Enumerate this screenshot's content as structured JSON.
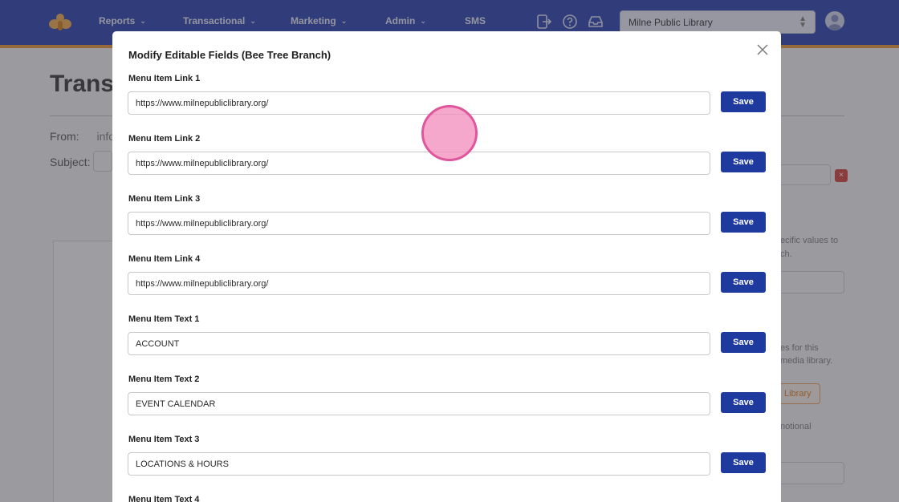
{
  "nav": {
    "items": [
      {
        "label": "Reports",
        "has_menu": true
      },
      {
        "label": "Transactional",
        "has_menu": true
      },
      {
        "label": "Marketing",
        "has_menu": true
      },
      {
        "label": "Admin",
        "has_menu": true
      },
      {
        "label": "SMS",
        "has_menu": false
      }
    ],
    "icons": [
      "sign-out-icon",
      "help-icon",
      "inbox-icon"
    ],
    "org_select": "Milne Public Library",
    "colors": {
      "bar": "#3f51b5",
      "accent": "#e8a04c"
    }
  },
  "background": {
    "title": "Transa",
    "from_label": "From:",
    "from_value": "info",
    "subject_label": "Subject:",
    "right_fragments": [
      ":",
      "ecific values to",
      "ch.",
      "es for this",
      "media library.",
      "notional"
    ],
    "library_button": "Library"
  },
  "modal": {
    "title": "Modify Editable Fields (Bee Tree Branch)",
    "save_label": "Save",
    "fields": [
      {
        "label": "Menu Item Link 1",
        "value": "https://www.milnepubliclibrary.org/"
      },
      {
        "label": "Menu Item Link 2",
        "value": "https://www.milnepubliclibrary.org/"
      },
      {
        "label": "Menu Item Link 3",
        "value": "https://www.milnepubliclibrary.org/"
      },
      {
        "label": "Menu Item Link 4",
        "value": "https://www.milnepubliclibrary.org/"
      },
      {
        "label": "Menu Item Text 1",
        "value": "ACCOUNT"
      },
      {
        "label": "Menu Item Text 2",
        "value": "EVENT CALENDAR"
      },
      {
        "label": "Menu Item Text 3",
        "value": "LOCATIONS & HOURS"
      },
      {
        "label": "Menu Item Text 4",
        "value": ""
      }
    ],
    "button_color": "#1f3a9e"
  }
}
